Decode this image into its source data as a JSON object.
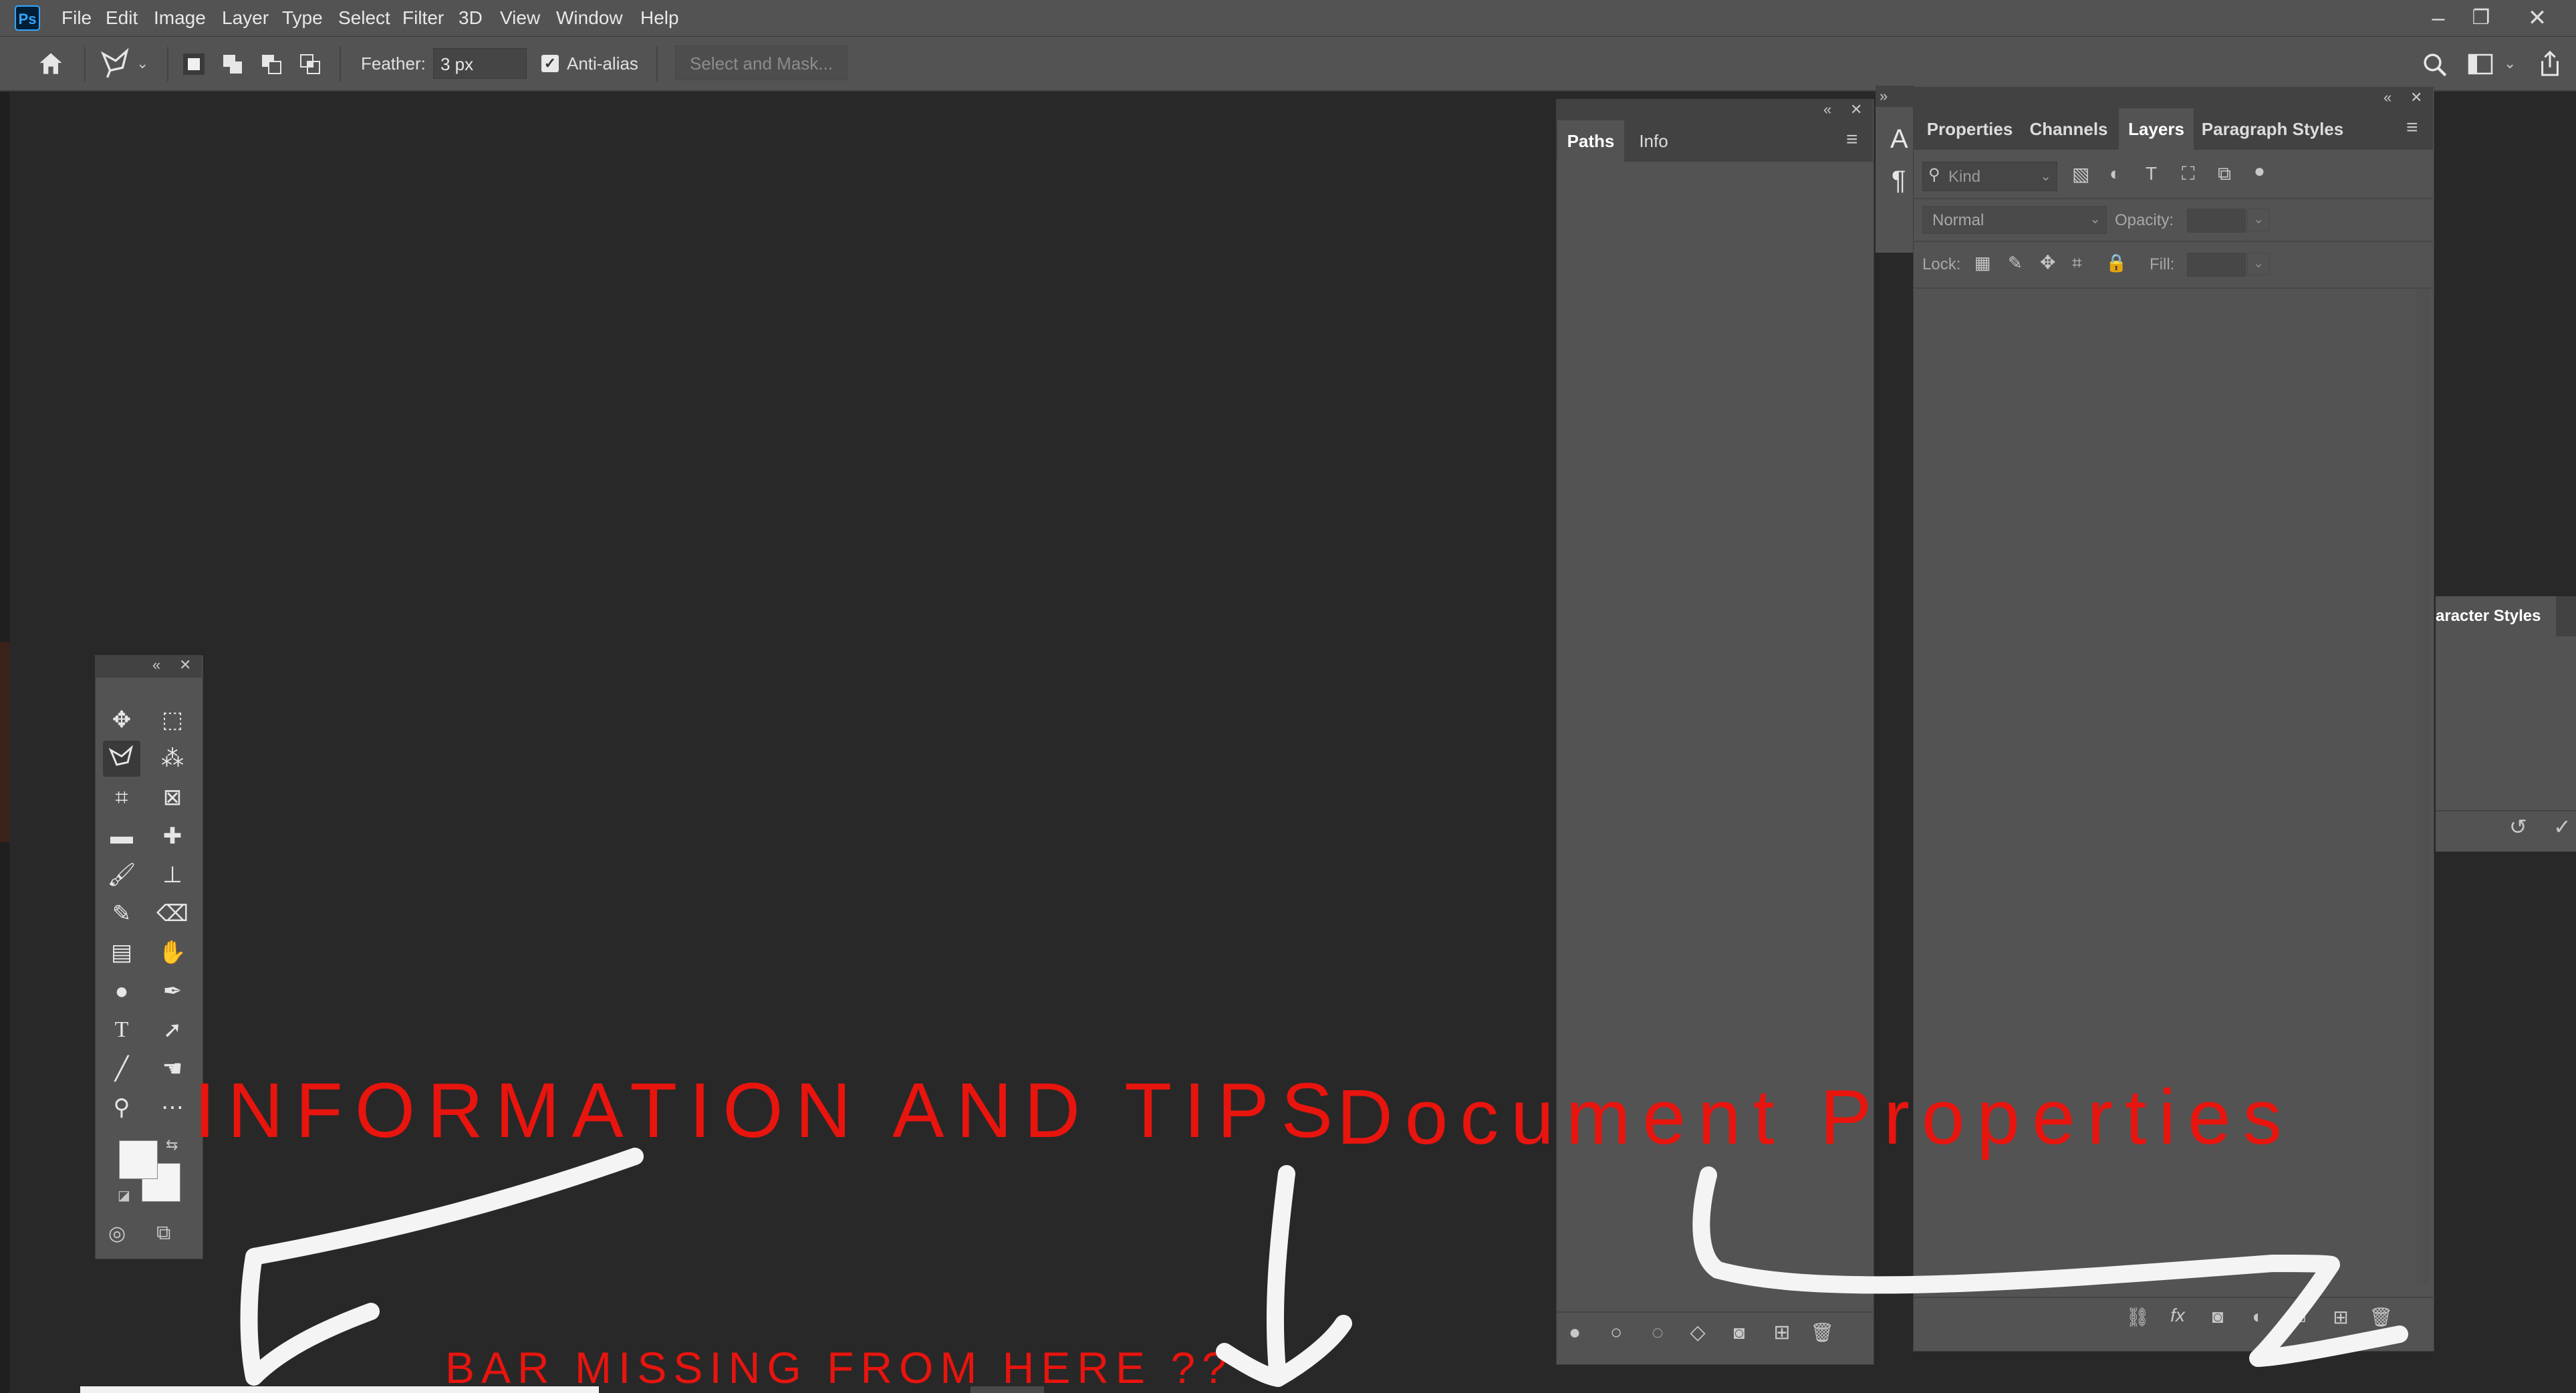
{
  "app": {
    "logo": "Ps"
  },
  "menu": [
    "File",
    "Edit",
    "Image",
    "Layer",
    "Type",
    "Select",
    "Filter",
    "3D",
    "View",
    "Window",
    "Help"
  ],
  "window_controls": {
    "minimize": "–",
    "restore": "❐",
    "close": "✕"
  },
  "options_bar": {
    "feather_label": "Feather:",
    "feather_value": "3 px",
    "antialias_label": "Anti-alias",
    "antialias_checked": true,
    "select_mask_label": "Select and Mask..."
  },
  "paths_panel": {
    "tabs": [
      "Paths",
      "Info"
    ],
    "active_tab": "Paths"
  },
  "layers_panel": {
    "tabs": [
      "Properties",
      "Channels",
      "Layers",
      "Paragraph Styles"
    ],
    "active_tab": "Layers",
    "filter_placeholder": "Kind",
    "blend_mode": "Normal",
    "opacity_label": "Opacity:",
    "lock_label": "Lock:",
    "fill_label": "Fill:"
  },
  "collapsed_panel_letters": [
    "A",
    "¶"
  ],
  "character_styles_panel": {
    "tab": "aracter Styles"
  },
  "annotations": {
    "info_tips": "INFORMATION AND TIPS",
    "doc_props": "Document Properties",
    "bar_missing": "BAR MISSING FROM HERE ??"
  },
  "colors": {
    "annotation_red": "#e8140e",
    "panel_bg": "#535353",
    "workspace_bg": "#282828"
  }
}
